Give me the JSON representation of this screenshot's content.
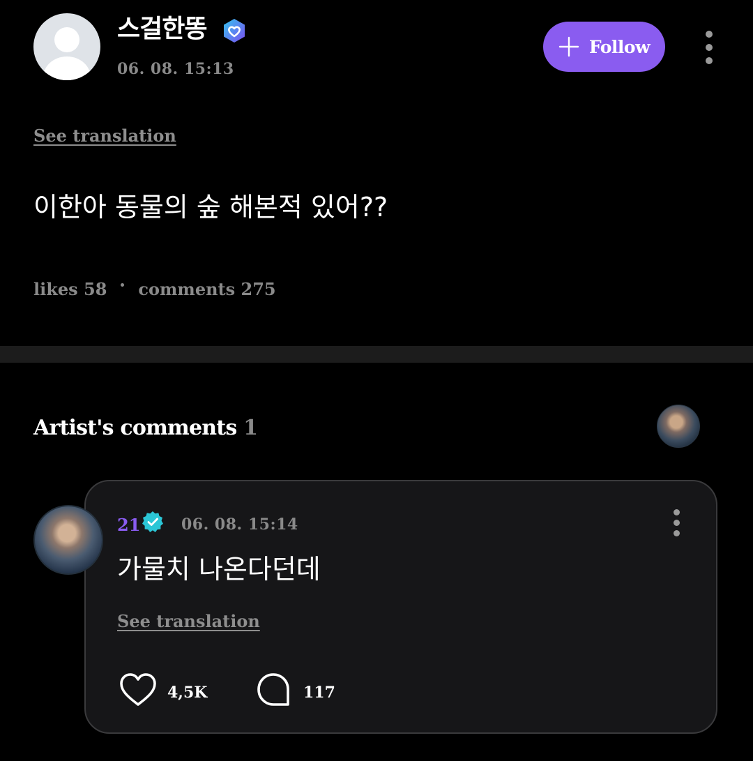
{
  "post": {
    "author": "스걸한똥",
    "time": "06. 08. 15:13",
    "follow_label": "Follow",
    "see_translation": "See translation",
    "body": "이한아 동물의 숲 해본적 있어??",
    "likes_text": "likes 58",
    "comments_text": "comments 275"
  },
  "artist_comments": {
    "title": "Artist's comments",
    "count": "1"
  },
  "comment": {
    "author": "21",
    "time": "06. 08. 15:14",
    "text": "가물치 나온다던데",
    "see_translation": "See translation",
    "likes": "4,5K",
    "replies": "117"
  },
  "colors": {
    "accent": "#8a5cf0",
    "background": "#000000",
    "card": "#161618",
    "muted": "#8a8a8a",
    "verified": "#2bc6d6"
  },
  "icons": [
    "heart-badge-icon",
    "plus-icon",
    "more-vertical-icon",
    "verified-icon",
    "heart-icon",
    "comment-bubble-icon"
  ]
}
